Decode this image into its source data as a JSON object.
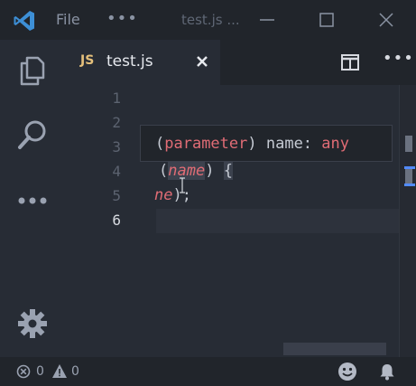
{
  "titlebar": {
    "menu_file": "File",
    "menu_more": "•••",
    "window_title": "test.js ..."
  },
  "tabs": [
    {
      "lang_badge": "JS",
      "label": "test.js"
    }
  ],
  "tab_actions": {
    "more": "•••"
  },
  "editor": {
    "line_numbers": [
      "1",
      "2",
      "3",
      "4",
      "5",
      "6"
    ],
    "active_line": "6",
    "code_lines": {
      "line4_open": "(",
      "line4_param": "name",
      "line4_close": ")",
      "line4_space": " ",
      "line4_brace": "{",
      "line5_param": "ne",
      "line5_rest": ");"
    }
  },
  "hover": {
    "open": "(",
    "kind": "parameter",
    "close": ")",
    "name": " name: ",
    "type": "any"
  },
  "statusbar": {
    "errors": "0",
    "warnings": "0"
  },
  "colors": {
    "background": "#272c35",
    "titlebar": "#21252b",
    "accent": "#528bff",
    "js_badge": "#e5c07b",
    "keyword": "#e06c75"
  }
}
